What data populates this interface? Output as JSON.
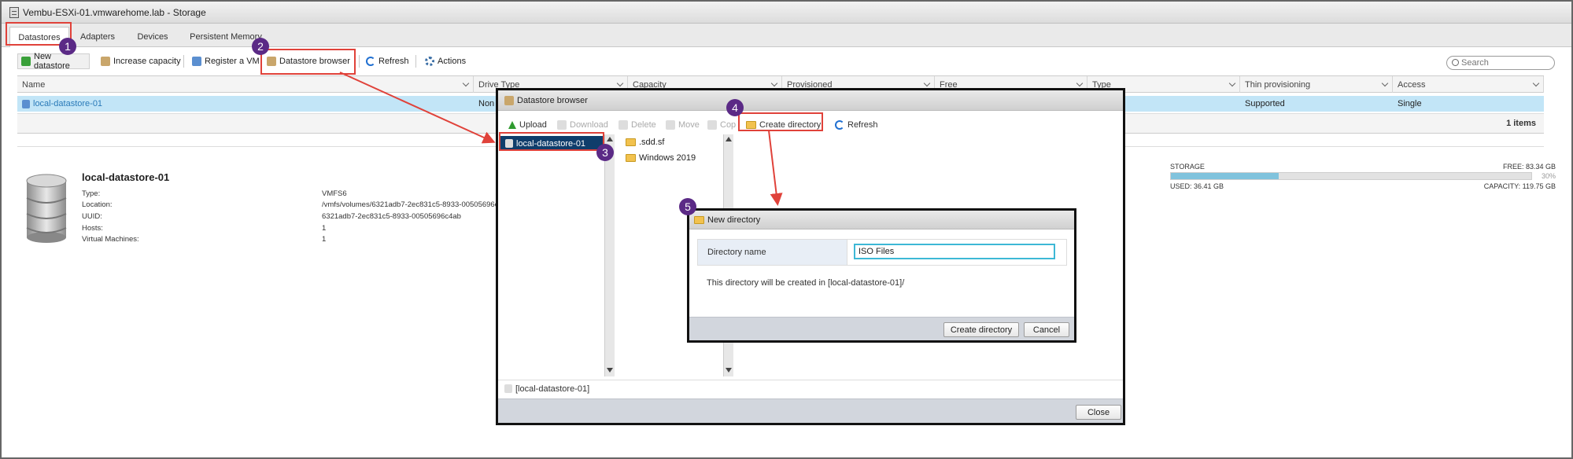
{
  "window": {
    "title": "Vembu-ESXi-01.vmwarehome.lab - Storage"
  },
  "tabs": [
    {
      "label": "Datastores"
    },
    {
      "label": "Adapters"
    },
    {
      "label": "Devices"
    },
    {
      "label": "Persistent Memory"
    }
  ],
  "toolbar": {
    "new_datastore": "New datastore",
    "increase_capacity": "Increase capacity",
    "register_vm": "Register a VM",
    "datastore_browser": "Datastore browser",
    "refresh": "Refresh",
    "actions": "Actions",
    "search_placeholder": "Search"
  },
  "table": {
    "columns": [
      "Name",
      "Drive Type",
      "Capacity",
      "Provisioned",
      "Free",
      "Type",
      "Thin provisioning",
      "Access"
    ],
    "row": {
      "name": "local-datastore-01",
      "drive_type": "Non",
      "thin": "Supported",
      "access": "Single"
    },
    "items_count": "1 items"
  },
  "details": {
    "title": "local-datastore-01",
    "labels": [
      "Type:",
      "Location:",
      "UUID:",
      "Hosts:",
      "Virtual Machines:"
    ],
    "values": [
      "VMFS6",
      "/vmfs/volumes/6321adb7-2ec831c5-8933-00505696c",
      "6321adb7-2ec831c5-8933-00505696c4ab",
      "1",
      "1"
    ]
  },
  "storage": {
    "label": "STORAGE",
    "free": "FREE: 83.34 GB",
    "percent_label": "30%",
    "used": "USED: 36.41 GB",
    "capacity": "CAPACITY: 119.75 GB",
    "used_fraction": 0.3
  },
  "browser": {
    "title": "Datastore browser",
    "upload": "Upload",
    "download": "Download",
    "delete": "Delete",
    "move": "Move",
    "copy": "Cop",
    "create_directory": "Create directory",
    "refresh": "Refresh",
    "datastore": "local-datastore-01",
    "files": [
      ".sdd.sf",
      "Windows 2019"
    ],
    "path": "[local-datastore-01]",
    "close": "Close"
  },
  "new_directory": {
    "title": "New directory",
    "label": "Directory name",
    "value": "ISO Files",
    "hint": "This directory will be created in [local-datastore-01]/",
    "create": "Create directory",
    "cancel": "Cancel"
  },
  "badges": [
    "1",
    "2",
    "3",
    "4",
    "5"
  ],
  "colors": {
    "highlight": "#e0423a",
    "badge": "#5b2a86",
    "selection": "#c2e5f7"
  }
}
